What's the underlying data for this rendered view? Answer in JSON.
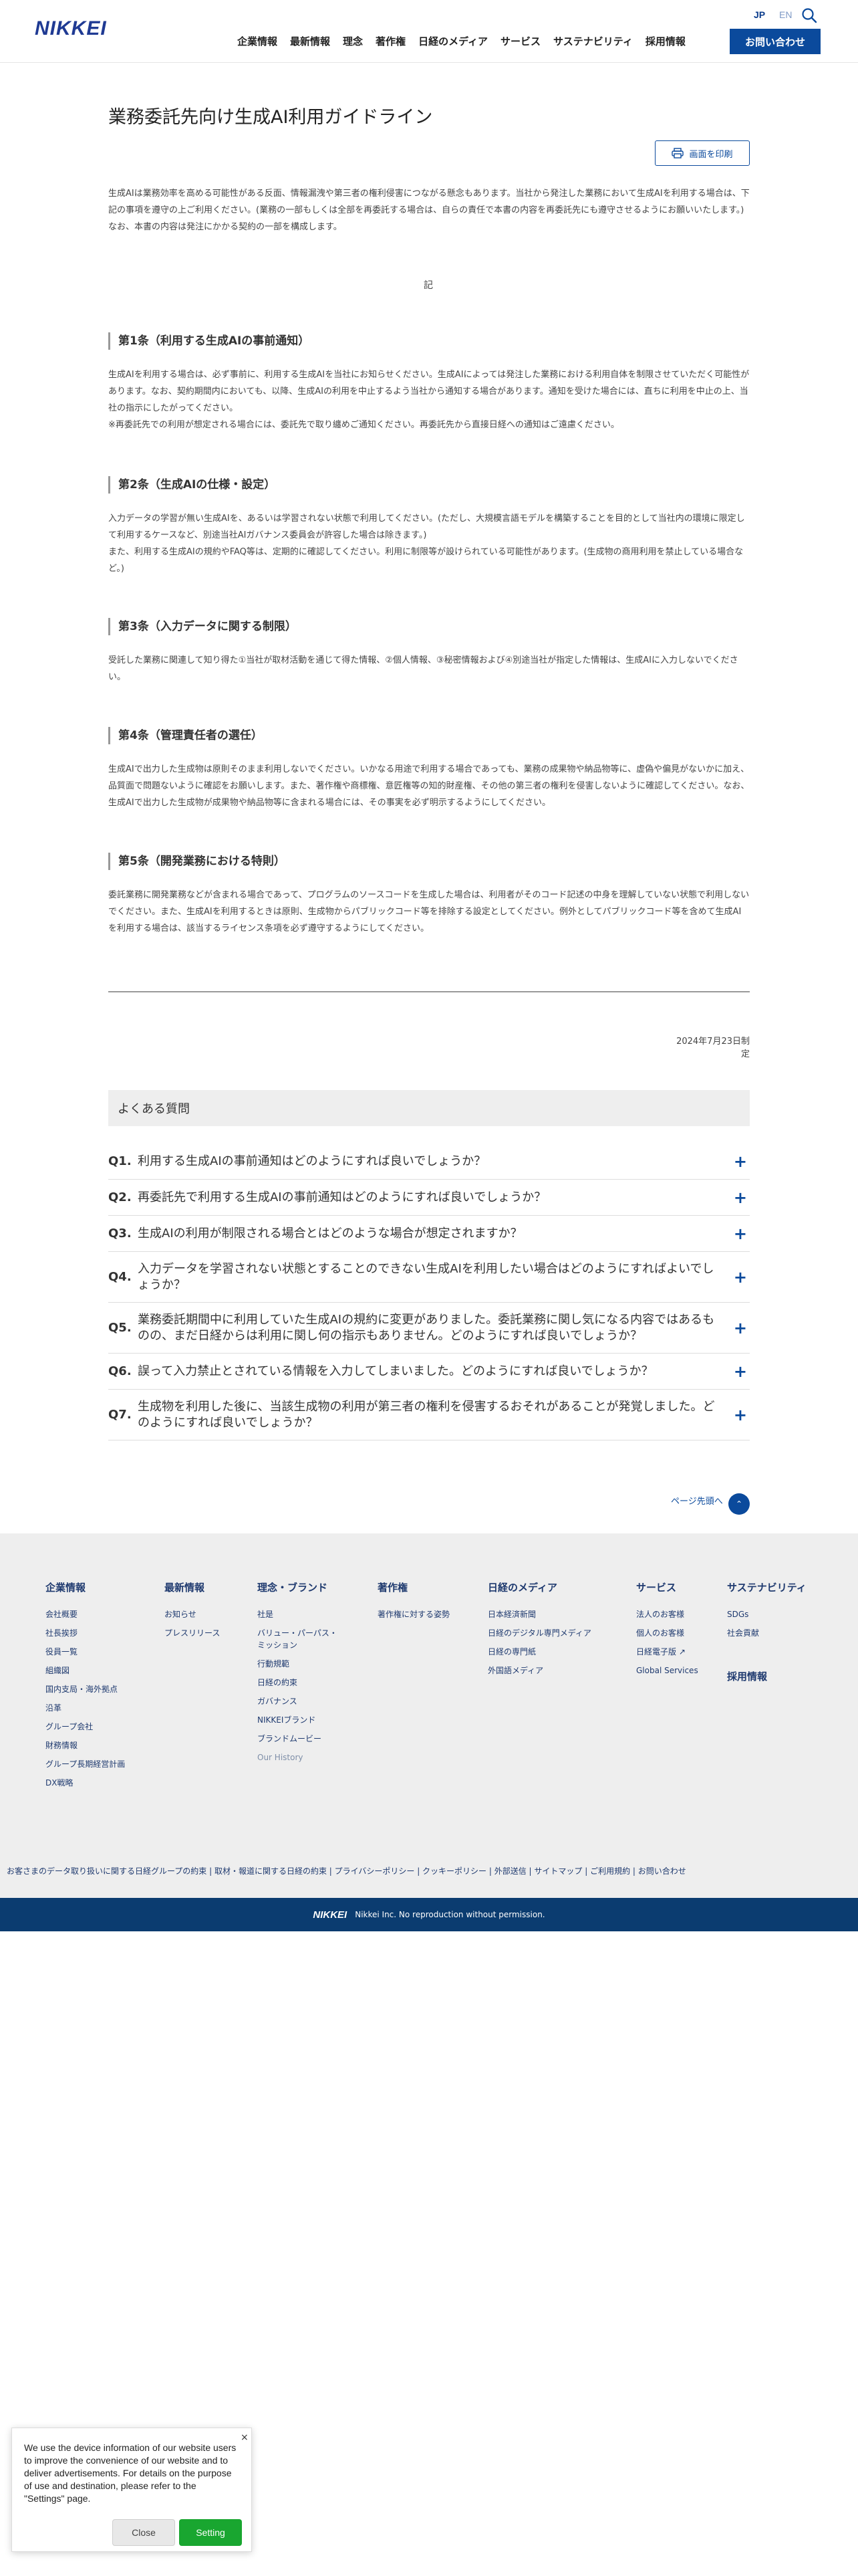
{
  "header": {
    "logo": "NIKKEI",
    "lang_jp": "JP",
    "lang_en": "EN",
    "nav": [
      "企業情報",
      "最新情報",
      "理念",
      "著作権",
      "日経のメディア",
      "サービス",
      "サステナビリティ",
      "採用情報"
    ],
    "contact": "お問い合わせ",
    "search_icon": "search-icon"
  },
  "main": {
    "title": "業務委託先向け生成AI利用ガイドライン",
    "print_label": "画面を印刷",
    "intro": "生成AIは業務効率を高める可能性がある反面、情報漏洩や第三者の権利侵害につながる懸念もあります。当社から発注した業務において生成AIを利用する場合は、下記の事項を遵守の上ご利用ください。(業務の一部もしくは全部を再委託する場合は、自らの責任で本書の内容を再委託先にも遵守させるようにお願いいたします。) なお、本書の内容は発注にかかる契約の一部を構成します。",
    "ki": "記",
    "articles": [
      {
        "heading": "第1条（利用する生成AIの事前通知）",
        "body": "生成AIを利用する場合は、必ず事前に、利用する生成AIを当社にお知らせください。生成AIによっては発注した業務における利用自体を制限させていただく可能性があります。なお、契約期間内においても、以降、生成AIの利用を中止するよう当社から通知する場合があります。通知を受けた場合には、直ちに利用を中止の上、当社の指示にしたがってください。\n※再委託先での利用が想定される場合には、委託先で取り纏めご通知ください。再委託先から直接日経への通知はご遠慮ください。"
      },
      {
        "heading": "第2条（生成AIの仕様・設定）",
        "body": "入力データの学習が無い生成AIを、あるいは学習されない状態で利用してください。(ただし、大規模言語モデルを構築することを目的として当社内の環境に限定して利用するケースなど、別途当社AIガバナンス委員会が許容した場合は除きます。)\nまた、利用する生成AIの規約やFAQ等は、定期的に確認してください。利用に制限等が設けられている可能性があります。(生成物の商用利用を禁止している場合など。)"
      },
      {
        "heading": "第3条（入力データに関する制限）",
        "body": "受託した業務に関連して知り得た①当社が取材活動を通じて得た情報、②個人情報、③秘密情報および④別途当社が指定した情報は、生成AIに入力しないでください。"
      },
      {
        "heading": "第4条（管理責任者の選任）",
        "body": "生成AIで出力した生成物は原則そのまま利用しないでください。いかなる用途で利用する場合であっても、業務の成果物や納品物等に、虚偽や偏見がないかに加え、品質面で問題ないように確認をお願いします。また、著作権や商標権、意匠権等の知的財産権、その他の第三者の権利を侵害しないように確認してください。なお、生成AIで出力した生成物が成果物や納品物等に含まれる場合には、その事実を必ず明示するようにしてください。"
      },
      {
        "heading": "第5条（開発業務における特則）",
        "body": "委託業務に開発業務などが含まれる場合であって、プログラムのソースコードを生成した場合は、利用者がそのコード記述の中身を理解していない状態で利用しないでください。また、生成AIを利用するときは原則、生成物からパブリックコード等を排除する設定としてください。例外としてパブリックコード等を含めて生成AIを利用する場合は、該当するライセンス条項を必ず遵守するようにしてください。"
      }
    ],
    "date": "2024年7月23日制定"
  },
  "faq": {
    "title": "よくある質問",
    "items": [
      {
        "q": "Q1.",
        "text": "利用する生成AIの事前通知はどのようにすれば良いでしょうか？"
      },
      {
        "q": "Q2.",
        "text": "再委託先で利用する生成AIの事前通知はどのようにすれば良いでしょうか？"
      },
      {
        "q": "Q3.",
        "text": "生成AIの利用が制限される場合とはどのような場合が想定されますか？"
      },
      {
        "q": "Q4.",
        "text": "入力データを学習されない状態とすることのできない生成AIを利用したい場合はどのようにすればよいでしょうか？"
      },
      {
        "q": "Q5.",
        "text": "業務委託期間中に利用していた生成AIの規約に変更がありました。委託業務に関し気になる内容ではあるものの、まだ日経からは利用に関し何の指示もありません。どのようにすれば良いでしょうか？"
      },
      {
        "q": "Q6.",
        "text": "誤って入力禁止とされている情報を入力してしまいました。どのようにすれば良いでしょうか？"
      },
      {
        "q": "Q7.",
        "text": "生成物を利用した後に、当該生成物の利用が第三者の権利を侵害するおそれがあることが発覚しました。どのようにすれば良いでしょうか？"
      }
    ]
  },
  "pagetop": {
    "label": "ページ先頭へ",
    "icon": "chevron-up-icon"
  },
  "footer": {
    "columns": [
      {
        "title": "企業情報",
        "items": [
          "会社概要",
          "社長挨拶",
          "役員一覧",
          "組織図",
          "国内支局・海外拠点",
          "沿革",
          "グループ会社",
          "財務情報",
          "グループ長期経営計画",
          "DX戦略"
        ]
      },
      {
        "title": "最新情報",
        "items": [
          "お知らせ",
          "プレスリリース"
        ]
      },
      {
        "title": "理念・ブランド",
        "items": [
          "社是",
          "バリュー・パーパス・ミッション",
          "行動規範",
          "日経の約束",
          "ガバナンス",
          "NIKKEIブランド",
          "ブランドムービー",
          "Our History"
        ]
      },
      {
        "title": "著作権",
        "items": [
          "著作権に対する姿勢"
        ]
      },
      {
        "title": "日経のメディア",
        "items": [
          "日本経済新聞",
          "日経のデジタル専門メディア",
          "日経の専門紙",
          "外国語メディア"
        ]
      },
      {
        "title": "サービス",
        "items": [
          "法人のお客様",
          "個人のお客様",
          "日経電子版",
          "Global Services"
        ]
      },
      {
        "title": "サステナビリティ",
        "items": [
          "SDGs",
          "社会貢献"
        ],
        "second_title": "採用情報"
      }
    ],
    "links": "お客さまのデータ取り扱いに関する日経グループの約束 | 取材・報道に関する日経の約束 | プライバシーポリシー | クッキーポリシー | 外部送信 | サイトマップ | ご利用規約 | お問い合わせ",
    "copyright_logo": "NIKKEI",
    "copyright": "Nikkei Inc. No reproduction without permission."
  },
  "cookie": {
    "message": "We use the device information of our website users to improve the convenience of our website and to deliver advertisements. For details on the purpose of use and destination, please refer to the \"Settings\" page.",
    "close": "Close",
    "setting": "Setting",
    "close_icon": "×"
  },
  "colors": {
    "brand": "#0b4a9c",
    "footer_bg": "#eeeeee",
    "copy_bar": "#0b3c70",
    "cookie_setting": "#19a630"
  }
}
